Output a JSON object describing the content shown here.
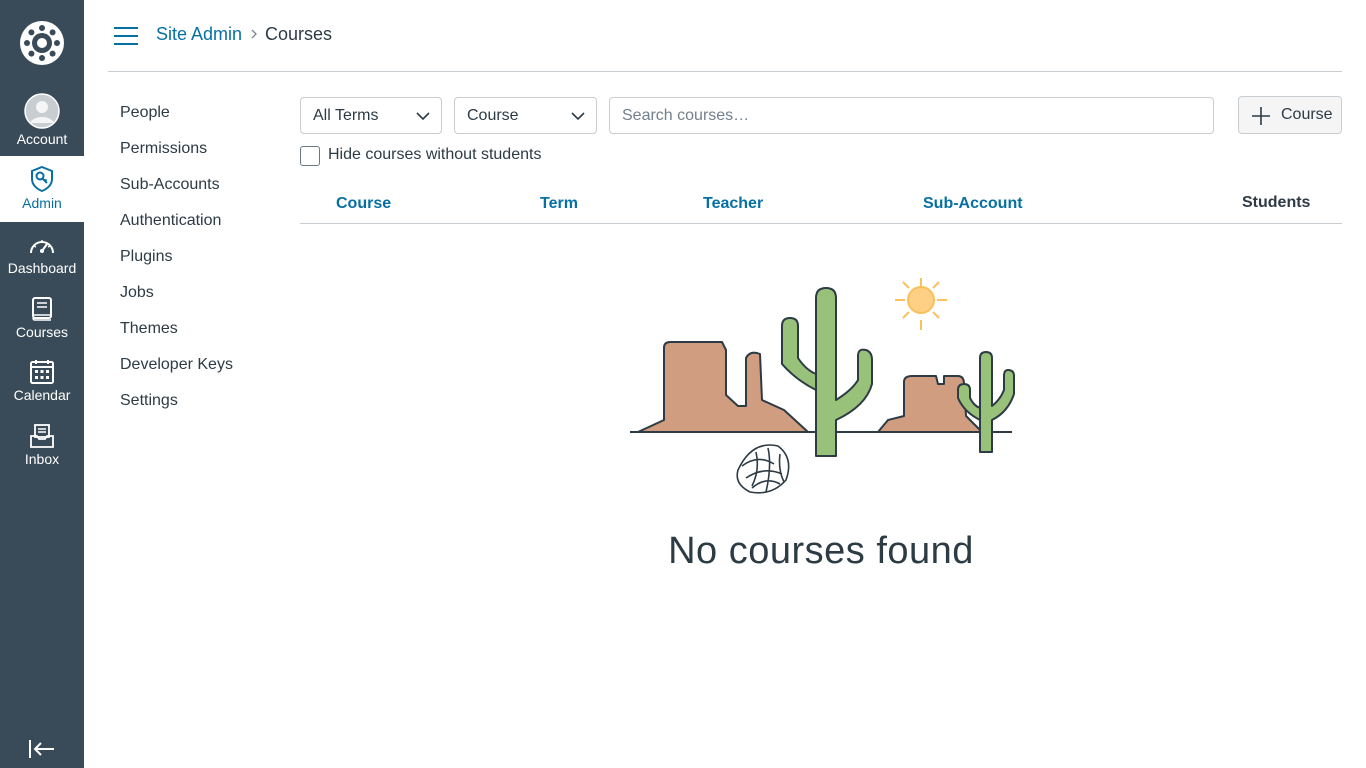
{
  "global_nav": {
    "items": [
      {
        "key": "account",
        "label": "Account"
      },
      {
        "key": "admin",
        "label": "Admin"
      },
      {
        "key": "dashboard",
        "label": "Dashboard"
      },
      {
        "key": "courses",
        "label": "Courses"
      },
      {
        "key": "calendar",
        "label": "Calendar"
      },
      {
        "key": "inbox",
        "label": "Inbox"
      }
    ],
    "active": "admin"
  },
  "breadcrumb": {
    "parent": "Site Admin",
    "current": "Courses"
  },
  "subnav": {
    "items": [
      "People",
      "Permissions",
      "Sub-Accounts",
      "Authentication",
      "Plugins",
      "Jobs",
      "Themes",
      "Developer Keys",
      "Settings"
    ]
  },
  "filters": {
    "term_select": "All Terms",
    "type_select": "Course",
    "search_placeholder": "Search courses…",
    "add_button": "Course",
    "hide_checkbox_label": "Hide courses without students",
    "hide_checkbox_checked": false
  },
  "table": {
    "columns": [
      "Course",
      "Term",
      "Teacher",
      "Sub-Account",
      "Students"
    ]
  },
  "empty_state": {
    "message": "No courses found"
  },
  "colors": {
    "nav_bg": "#394b58",
    "link": "#0770a3",
    "text": "#2d3b45",
    "border": "#c7cdd1"
  }
}
